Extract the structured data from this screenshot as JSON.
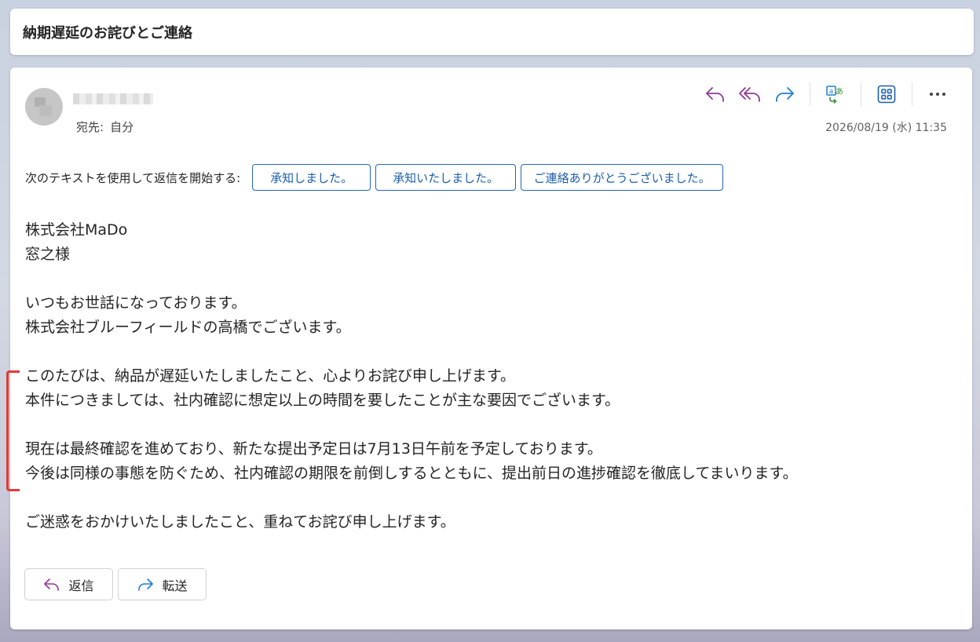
{
  "subject": "納期遅延のお詫びとご連絡",
  "header": {
    "to_label": "宛先:",
    "to_value": "自分",
    "datetime": "2026/08/19 (水) 11:35"
  },
  "toolbar": {
    "icons": [
      "reply-icon",
      "reply-all-icon",
      "forward-icon",
      "translate-icon",
      "apps-icon",
      "more-icon"
    ]
  },
  "suggestions": {
    "label": "次のテキストを使用して返信を開始する:",
    "chips": [
      "承知しました。",
      "承知いたしました。",
      "ご連絡ありがとうございました。"
    ]
  },
  "body": {
    "lines": [
      "株式会社MaDo",
      "窓之様",
      "",
      "いつもお世話になっております。",
      "株式会社ブルーフィールドの高橋でございます。",
      "",
      "このたびは、納品が遅延いたしましたこと、心よりお詫び申し上げます。",
      "本件につきましては、社内確認に想定以上の時間を要したことが主な要因でございます。",
      "",
      "現在は最終確認を進めており、新たな提出予定日は7月13日午前を予定しております。",
      "今後は同様の事態を防ぐため、社内確認の期限を前倒しするとともに、提出前日の進捗確認を徹底してまいります。",
      "",
      "ご迷惑をおかけいたしましたこと、重ねてお詫び申し上げます。"
    ]
  },
  "actions": {
    "reply_label": "返信",
    "forward_label": "転送"
  },
  "colors": {
    "accent": "#1c5fae",
    "reply_icon": "#8e3a96",
    "forward_icon": "#1f7fd1",
    "annotation": "#e53935"
  }
}
